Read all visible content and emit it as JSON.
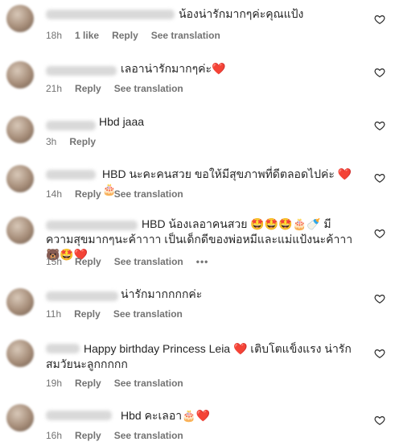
{
  "comments": [
    {
      "text": "น้องน่ารักมากๆค่ะคุณแป้ง",
      "time": "18h",
      "likes": "1 like",
      "reply": "Reply",
      "translate": "See translation"
    },
    {
      "text": "เลอาน่ารักมากๆค่ะ❤️",
      "time": "21h",
      "reply": "Reply",
      "translate": "See translation"
    },
    {
      "text": "Hbd jaaa",
      "time": "3h",
      "reply": "Reply"
    },
    {
      "text": "HBD นะคะคนสวย ขอให้มีสุขภาพที่ดีตลอดไปค่ะ ❤️🎂",
      "time": "14h",
      "reply": "Reply",
      "translate": "See translation"
    },
    {
      "text": "HBD น้องเลอาคนสวย 🤩🤩🤩🎂🍼 มีความสุขมากๆนะค้าาาา เป็นเด็กดีของพ่อหมีและแม่แป้งนะค้าาา 🐻🤩❤️",
      "time": "15h",
      "reply": "Reply",
      "translate": "See translation",
      "more": "•••"
    },
    {
      "text": "น่ารักมากกกกค่ะ",
      "time": "11h",
      "reply": "Reply",
      "translate": "See translation"
    },
    {
      "text": "Happy birthday Princess Leia ❤️ เติบโตแข็งแรง น่ารักสมวัยนะลูกกกกก",
      "time": "19h",
      "reply": "Reply",
      "translate": "See translation"
    },
    {
      "text": "Hbd คะเลอา🎂❤️",
      "time": "16h",
      "reply": "Reply",
      "translate": "See translation"
    }
  ],
  "icons": {
    "like": "heart-outline-icon"
  }
}
